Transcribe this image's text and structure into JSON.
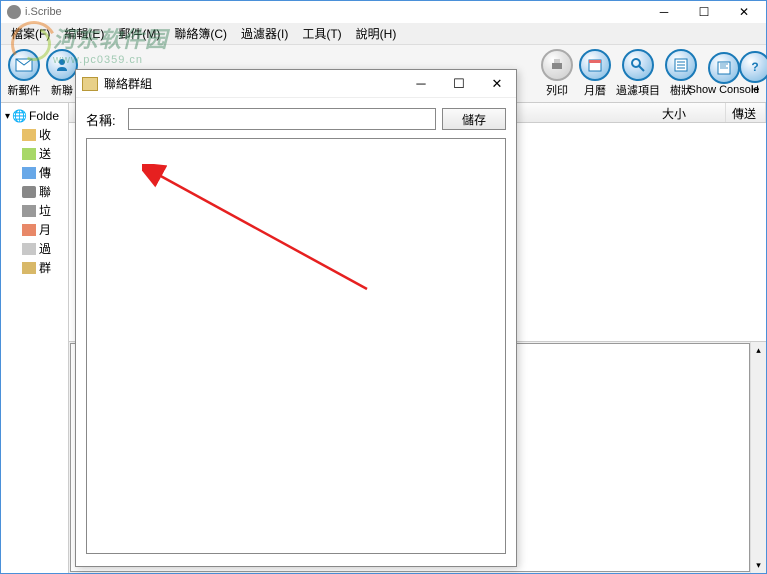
{
  "main_title": "i.Scribe",
  "menu": {
    "file": "檔案(F)",
    "edit": "編輯(E)",
    "mail": "郵件(M)",
    "contacts": "聯絡簿(C)",
    "filters": "過濾器(I)",
    "tools": "工具(T)",
    "help": "說明(H)"
  },
  "toolbar": {
    "new_mail": "新郵件",
    "new_contact": "新聯",
    "print": "列印",
    "calendar": "月曆",
    "filter_items": "過濾項目",
    "tree": "樹狀",
    "show_console": "Show Console",
    "h": "H"
  },
  "tree": {
    "root": "Folde",
    "items": [
      "收",
      "送",
      "傳",
      "聯",
      "垃",
      "月",
      "過",
      "群"
    ]
  },
  "list_headers": {
    "size": "大小",
    "send": "傳送"
  },
  "dialog": {
    "title": "聯絡群組",
    "name_label": "名稱:",
    "name_value": "",
    "save": "儲存"
  },
  "watermark": {
    "cn": "河东软件园",
    "url": "www.pc0359.cn"
  }
}
